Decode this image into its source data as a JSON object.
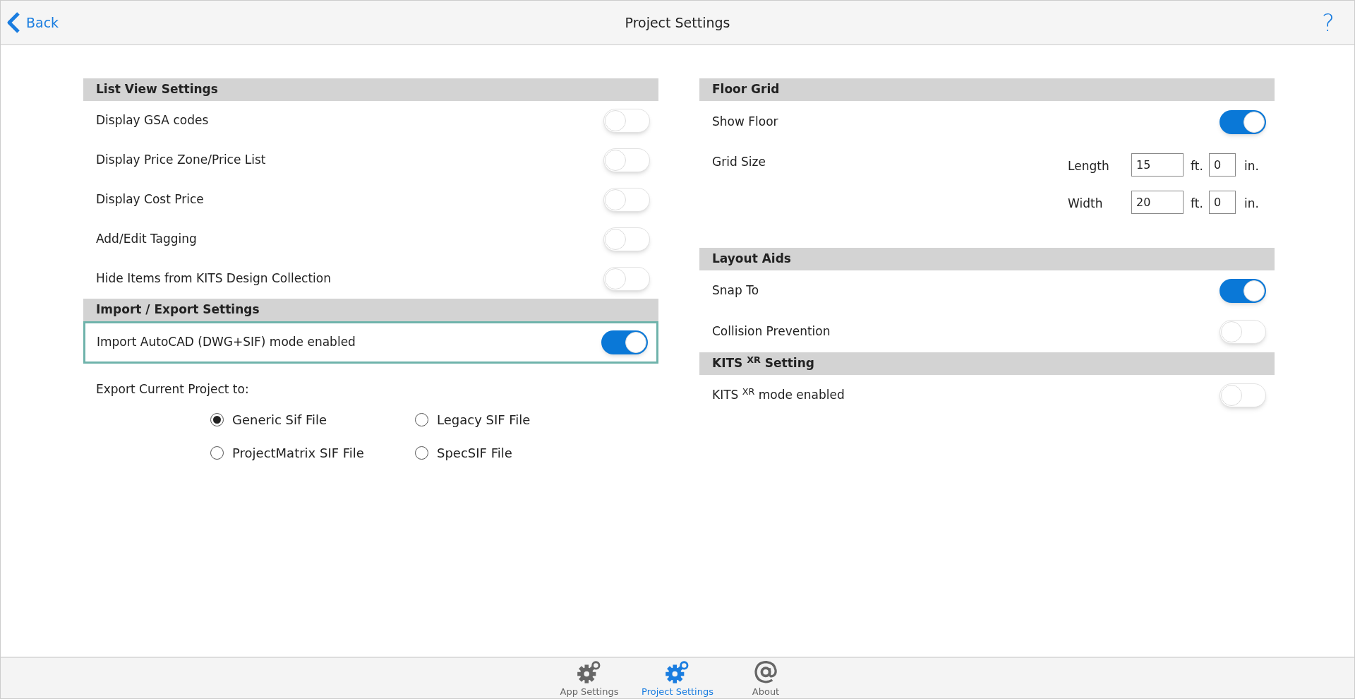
{
  "header": {
    "back": "Back",
    "title": "Project Settings",
    "help": "?"
  },
  "left_sections": [
    {
      "title": "List View Settings",
      "rows": [
        {
          "label": "Display GSA codes",
          "on": false,
          "highlighted": false
        },
        {
          "label": "Display Price Zone/Price List",
          "on": false,
          "highlighted": false
        },
        {
          "label": "Display Cost Price",
          "on": false,
          "highlighted": false
        },
        {
          "label": "Add/Edit Tagging",
          "on": false,
          "highlighted": false
        },
        {
          "label": "Hide Items from KITS Design Collection",
          "on": false,
          "highlighted": false
        }
      ]
    },
    {
      "title": "Import / Export Settings",
      "rows": [
        {
          "label": "Import AutoCAD (DWG+SIF) mode enabled",
          "on": true,
          "highlighted": true
        }
      ]
    }
  ],
  "export": {
    "label": "Export Current Project to:",
    "options": [
      {
        "label": "Generic Sif File",
        "selected": true
      },
      {
        "label": "Legacy SIF File",
        "selected": false
      },
      {
        "label": "ProjectMatrix SIF File",
        "selected": false
      },
      {
        "label": "SpecSIF File",
        "selected": false
      }
    ]
  },
  "floor_grid": {
    "title": "Floor Grid",
    "show_floor": {
      "label": "Show Floor",
      "on": true
    },
    "grid_size": {
      "label": "Grid Size",
      "dims": [
        {
          "label": "Length",
          "feet": "15",
          "feet_unit": "ft.",
          "inches": "0",
          "inches_unit": "in."
        },
        {
          "label": "Width",
          "feet": "20",
          "feet_unit": "ft.",
          "inches": "0",
          "inches_unit": "in."
        }
      ]
    }
  },
  "right_sections": [
    {
      "title": "Layout Aids",
      "rows": [
        {
          "label": "Snap To",
          "on": true,
          "highlighted": false
        },
        {
          "label": "Collision Prevention",
          "on": false,
          "highlighted": false
        }
      ]
    },
    {
      "title": "KITS $^{XR}$ Setting",
      "rows": [
        {
          "label": "KITS $^{XR}$ mode enabled",
          "on": false,
          "highlighted": false
        }
      ]
    }
  ],
  "tab_bar": [
    {
      "kind": "gear",
      "label": "App Settings",
      "selected": false
    },
    {
      "kind": "gear",
      "label": "Project Settings",
      "selected": true
    },
    {
      "kind": "at",
      "label": "About",
      "selected": false
    }
  ]
}
